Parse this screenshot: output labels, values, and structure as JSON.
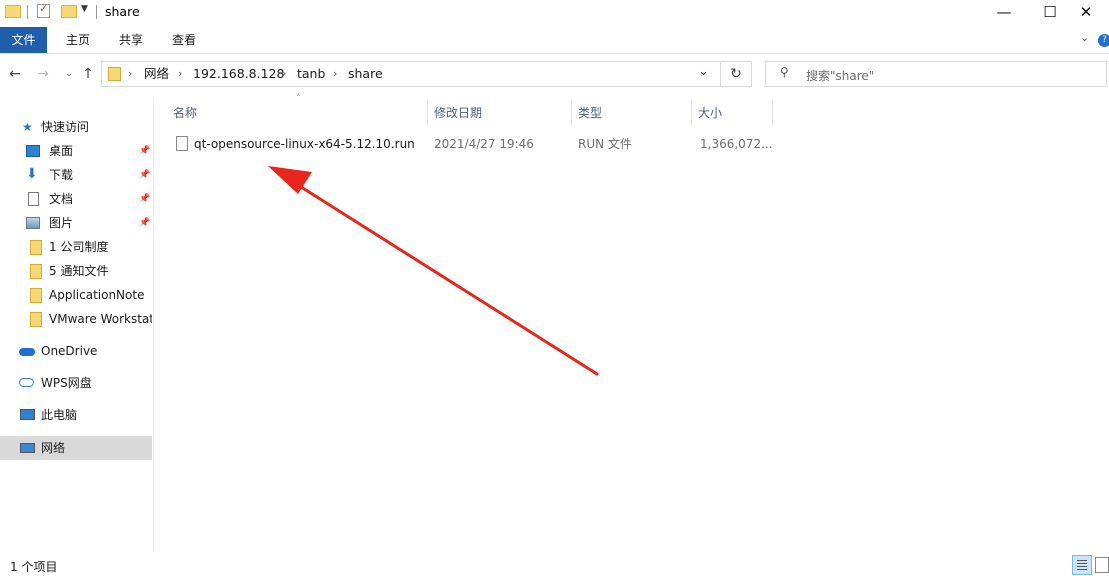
{
  "window": {
    "title": "share",
    "minimize_glyph": "—",
    "maximize_glyph": "☐",
    "close_glyph": "✕"
  },
  "ribbon": {
    "tabs": [
      {
        "label": "文件",
        "active": true
      },
      {
        "label": "主页",
        "active": false
      },
      {
        "label": "共享",
        "active": false
      },
      {
        "label": "查看",
        "active": false
      }
    ],
    "accent": "#1e5eab"
  },
  "address": {
    "crumbs": [
      "网络",
      "192.168.8.128",
      "tanb",
      "share"
    ],
    "dropdown_glyph": "⌄",
    "refresh_glyph": "↻"
  },
  "search": {
    "placeholder": "搜索\"share\""
  },
  "nav": {
    "quick_access": "快速访问",
    "items": [
      {
        "label": "桌面",
        "icon": "desktop-icon",
        "pinned": true
      },
      {
        "label": "下载",
        "icon": "download-icon",
        "pinned": true
      },
      {
        "label": "文档",
        "icon": "document-icon",
        "pinned": true
      },
      {
        "label": "图片",
        "icon": "picture-icon",
        "pinned": true
      },
      {
        "label": "1 公司制度",
        "icon": "folder-icon",
        "pinned": false
      },
      {
        "label": "5 通知文件",
        "icon": "folder-icon",
        "pinned": false
      },
      {
        "label": "ApplicationNote",
        "icon": "folder-icon",
        "pinned": false
      },
      {
        "label": "VMware Workstation",
        "icon": "folder-icon",
        "pinned": false
      }
    ],
    "onedrive": "OneDrive",
    "wps": "WPS网盘",
    "thispc": "此电脑",
    "network": "网络"
  },
  "list": {
    "columns": [
      "名称",
      "修改日期",
      "类型",
      "大小"
    ],
    "rows": [
      {
        "name": "qt-opensource-linux-x64-5.12.10.run",
        "date": "2021/4/27 19:46",
        "type": "RUN 文件",
        "size": "1,366,072..."
      }
    ]
  },
  "status": {
    "count": "1 个项目"
  },
  "annotation": {
    "color": "#e8261c"
  }
}
